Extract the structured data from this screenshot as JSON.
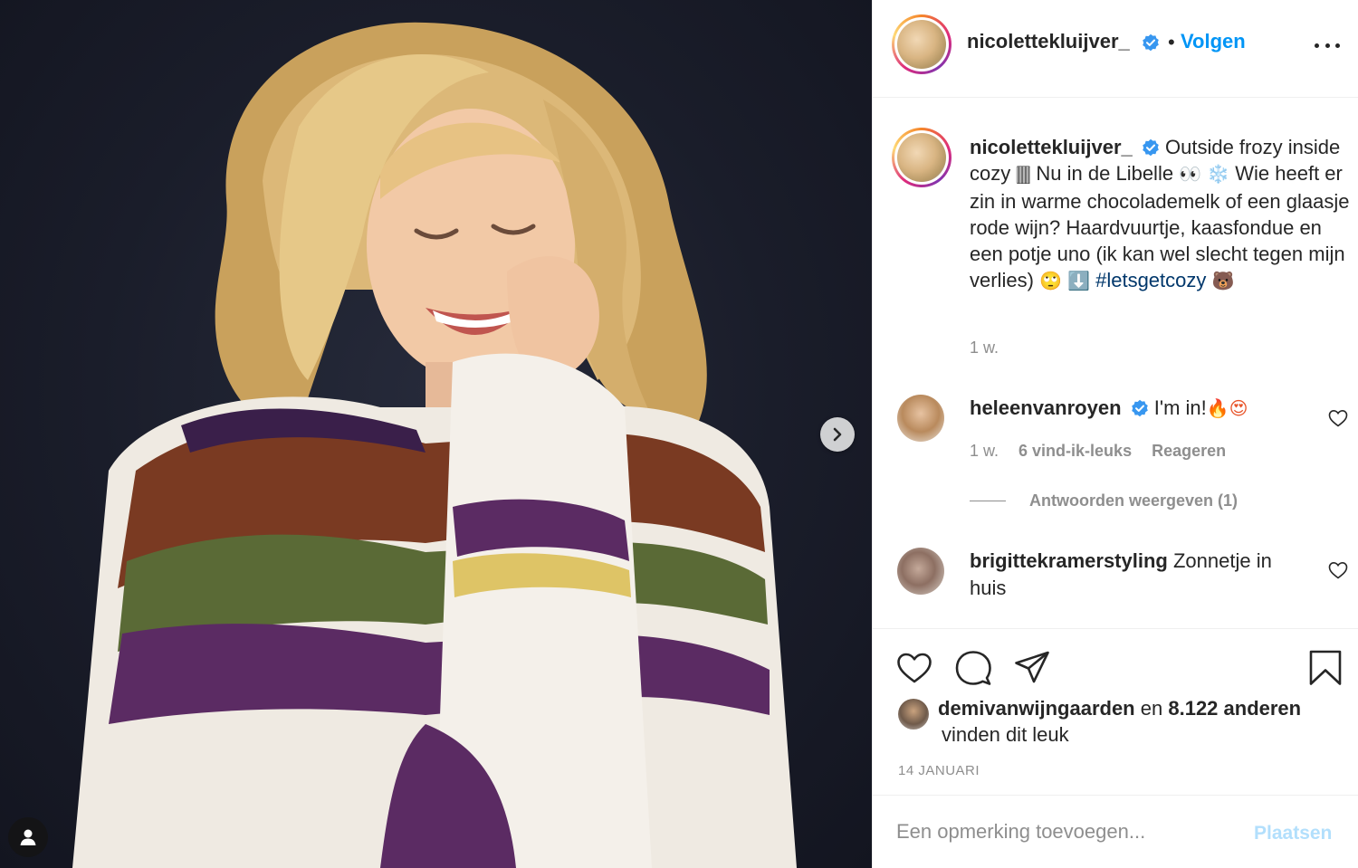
{
  "post": {
    "author": "nicolettekluijver_",
    "follow_label": "Volgen",
    "separator": "•",
    "caption": {
      "username": "nicolettekluijver_",
      "text_part1": "Outside frozy inside cozy",
      "emoji_1": "🀫",
      "text_part2": "Nu in de Libelle",
      "emoji_2": "👀",
      "emoji_3": "❄️",
      "text_part3": "Wie heeft er zin in warme chocolademelk of een glaasje rode wijn? Haardvuurtje, kaasfondue en een potje uno (ik kan wel slecht tegen mijn verlies)",
      "emoji_4": "🙄",
      "emoji_5": "⬇️",
      "hashtag": "#letsgetcozy",
      "emoji_6": "🐻",
      "time": "1 w."
    },
    "comments": [
      {
        "username": "heleenvanroyen",
        "text": "I'm in!",
        "emojis": "🔥😍",
        "time": "1 w.",
        "likes": "6 vind-ik-leuks",
        "reply_label": "Reageren",
        "view_replies": "Antwoorden weergeven (1)"
      },
      {
        "username": "brigittekramerstyling",
        "text": "Zonnetje in huis"
      }
    ],
    "likes": {
      "first_user": "demivanwijngaarden",
      "connector": "en",
      "others": "8.122 anderen",
      "suffix": "vinden dit leuk"
    },
    "date": "14 JANUARI",
    "add_comment": {
      "placeholder": "Een opmerking toevoegen...",
      "post_label": "Plaatsen"
    }
  },
  "colors": {
    "link_blue": "#0095f6",
    "hashtag_blue": "#00376b",
    "muted_gray": "#8e8e8e",
    "text": "#262626",
    "post_disabled": "#b2dffc"
  }
}
